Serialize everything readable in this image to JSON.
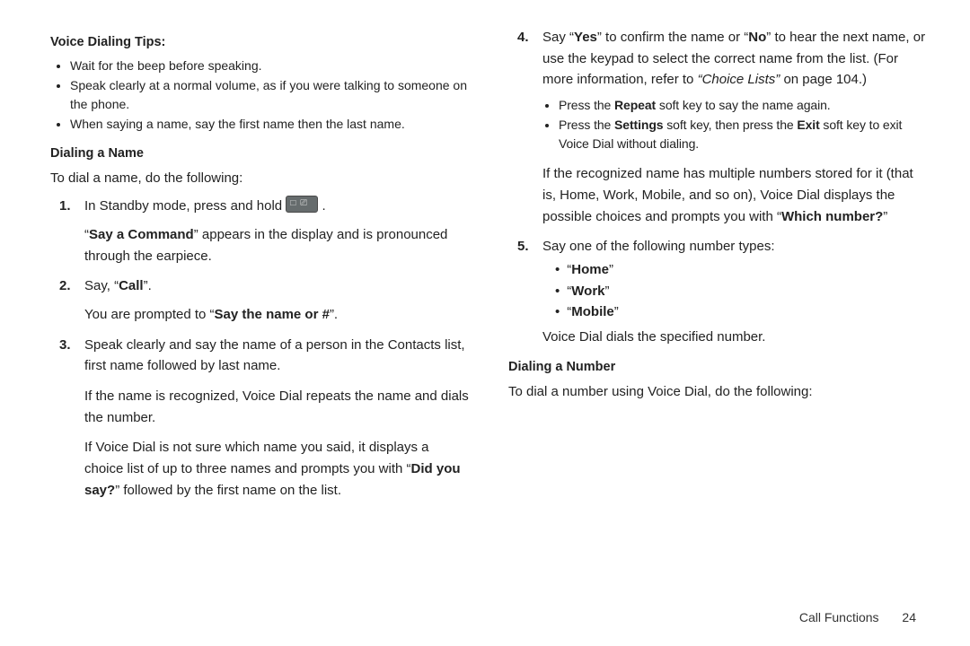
{
  "left": {
    "heading_tips": "Voice Dialing Tips:",
    "tips": [
      "Wait for the beep before speaking.",
      "Speak clearly at a normal volume, as if you were talking to someone on the phone.",
      "When saying a name, say the first name then the last name."
    ],
    "heading_dialname": "Dialing a Name",
    "dialname_intro": "To dial a name, do the following:",
    "step1_pre": "In Standby mode, press and hold ",
    "step1_post": " .",
    "step1_p2a": "“",
    "step1_p2_bold": "Say a Command",
    "step1_p2b": "” appears in the display and is pronounced through the earpiece.",
    "step2_pre": "Say, “",
    "step2_bold": "Call",
    "step2_post": "”.",
    "step2_p2a": "You are prompted to “",
    "step2_p2_bold": "Say the name or #",
    "step2_p2b": "”.",
    "step3_a": "Speak clearly and say the name of a person in the Contacts list, first name followed by last name.",
    "step3_b": "If the name is recognized, Voice Dial repeats the name and dials the number.",
    "step3_c_pre": "If Voice Dial is not sure which name you said, it displays a choice list of up to three names and prompts you with “",
    "step3_c_bold": "Did you say?",
    "step3_c_post": "” followed by the first name on the list."
  },
  "right": {
    "step4_a_pre": "Say “",
    "step4_a_yes": "Yes",
    "step4_a_mid1": "” to confirm the name or “",
    "step4_a_no": "No",
    "step4_a_mid2": "” to hear the next name, or use the keypad to select the correct name from the list. (For more information, refer to ",
    "step4_a_ital": "“Choice Lists”",
    "step4_a_post": "  on page 104.)",
    "step4_b1_pre": "Press the ",
    "step4_b1_bold": "Repeat",
    "step4_b1_post": " soft key to say the name again.",
    "step4_b2_pre": "Press the ",
    "step4_b2_bold1": "Settings",
    "step4_b2_mid": " soft key, then press the ",
    "step4_b2_bold2": "Exit",
    "step4_b2_post": " soft key to exit Voice Dial without dialing.",
    "step4_c_pre": "If the recognized name has multiple numbers stored for it (that is, Home, Work, Mobile, and so on), Voice Dial displays the possible choices and prompts you with “",
    "step4_c_bold": "Which number?",
    "step4_c_post": "”",
    "step5_intro": "Say one of the following number types:",
    "step5_items": [
      "Home",
      "Work",
      "Mobile"
    ],
    "step5_tail": "Voice Dial dials the specified number.",
    "heading_dialnumber": "Dialing a Number",
    "dialnumber_intro": "To dial a number using Voice Dial, do the following:"
  },
  "footer": {
    "section": "Call Functions",
    "page": "24"
  }
}
